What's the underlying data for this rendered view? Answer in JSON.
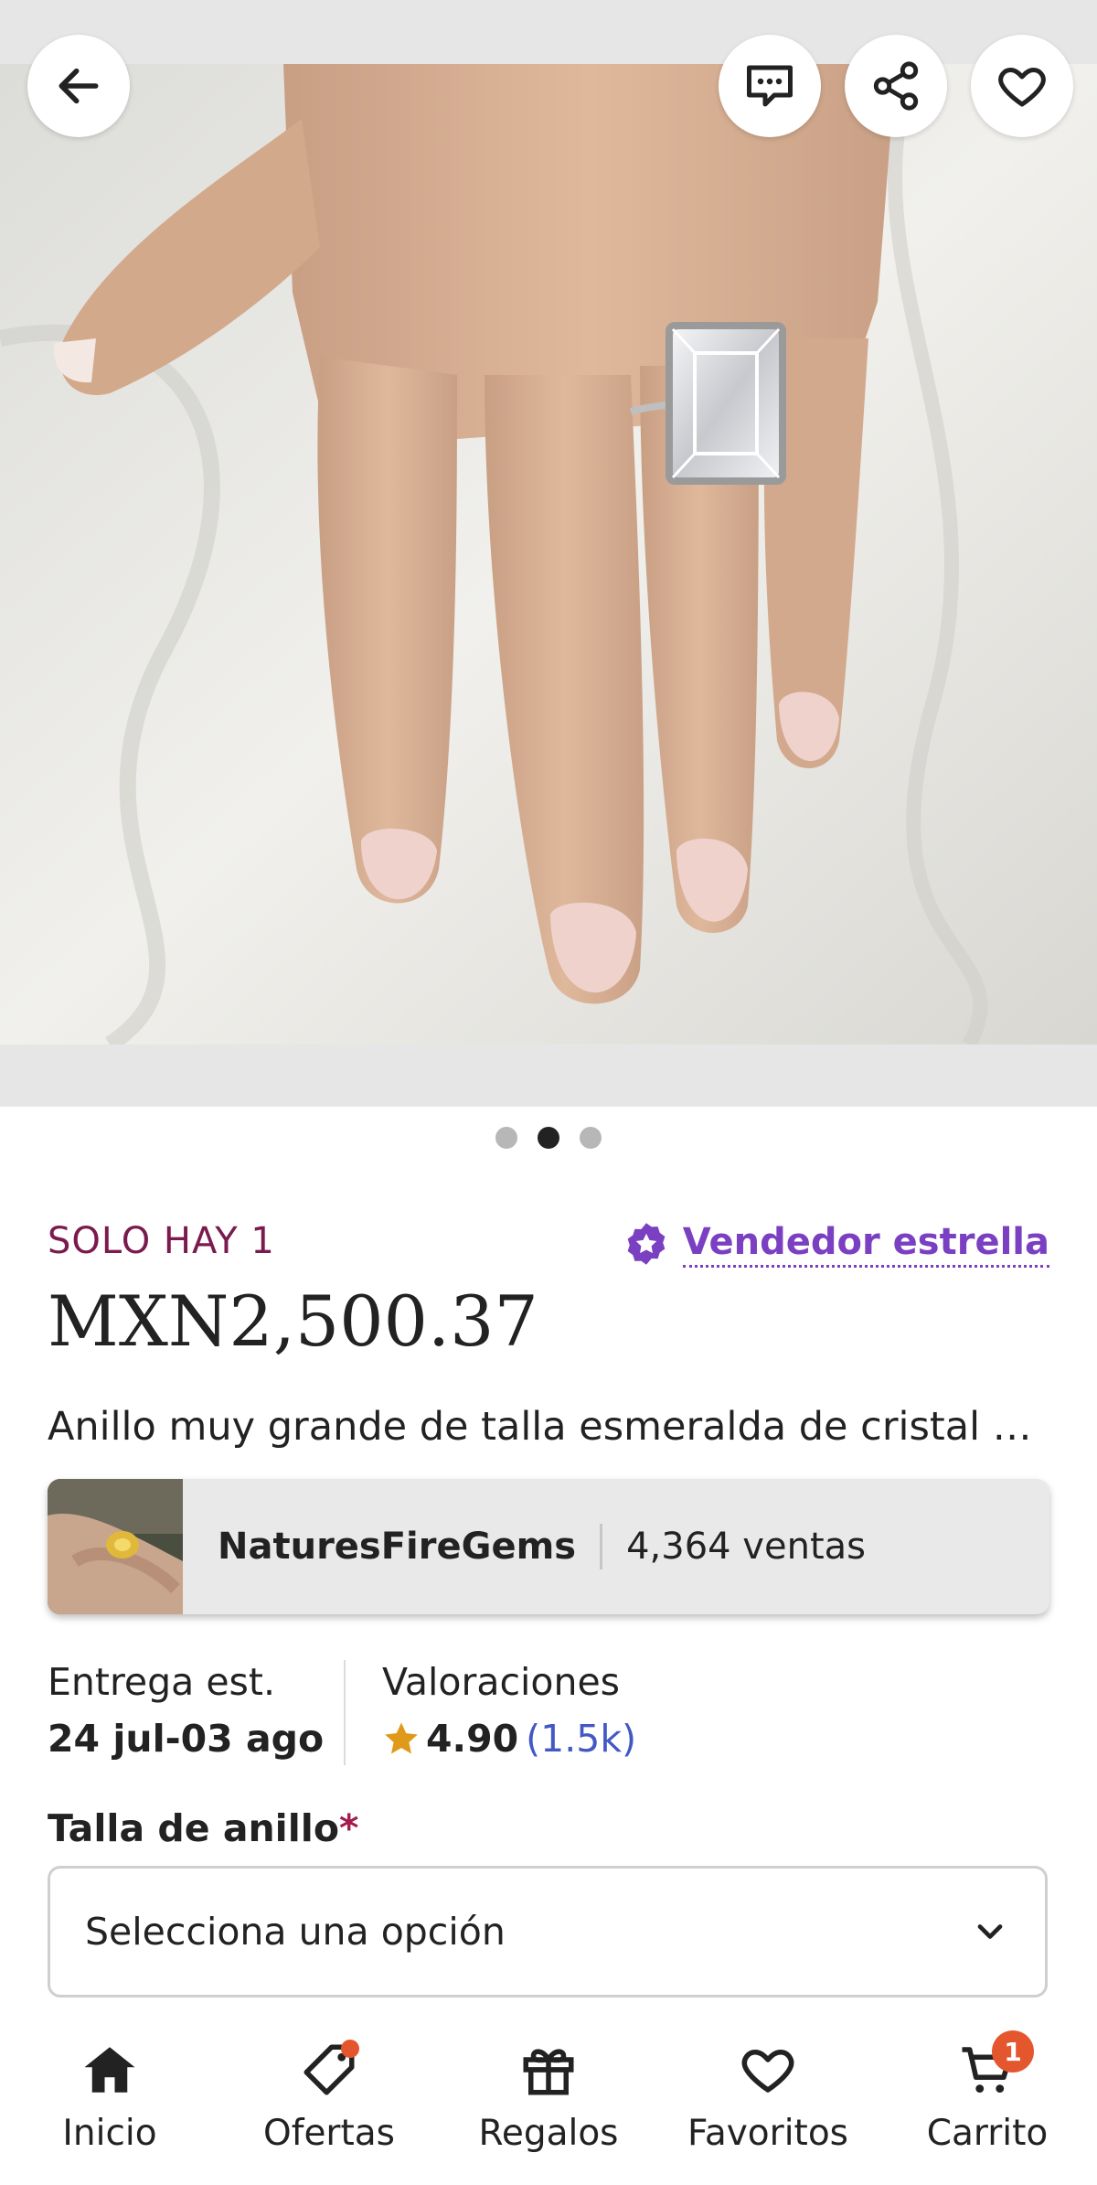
{
  "product": {
    "stock_label": "SOLO HAY 1",
    "star_seller_label": "Vendedor estrella",
    "price": "MXN2,500.37",
    "title": "Anillo muy grande de talla esmeralda de cristal …",
    "carousel": {
      "total": 3,
      "active_index": 1
    }
  },
  "shop": {
    "name": "NaturesFireGems",
    "sales": "4,364 ventas"
  },
  "delivery": {
    "label": "Entrega est.",
    "value": "24 jul-03 ago"
  },
  "rating": {
    "label": "Valoraciones",
    "value": "4.90",
    "count": "(1.5k)"
  },
  "options": {
    "size_label": "Talla de anillo",
    "required_mark": "*",
    "placeholder": "Selecciona una opción"
  },
  "nav": {
    "items": [
      {
        "label": "Inicio",
        "icon": "home-icon"
      },
      {
        "label": "Ofertas",
        "icon": "tag-icon"
      },
      {
        "label": "Regalos",
        "icon": "gift-icon"
      },
      {
        "label": "Favoritos",
        "icon": "heart-icon"
      },
      {
        "label": "Carrito",
        "icon": "cart-icon"
      }
    ],
    "cart_badge": "1"
  },
  "colors": {
    "stock": "#7a1a4e",
    "star_seller": "#7b3fc2",
    "rating_count": "#4258c4",
    "badge": "#e4572e"
  }
}
